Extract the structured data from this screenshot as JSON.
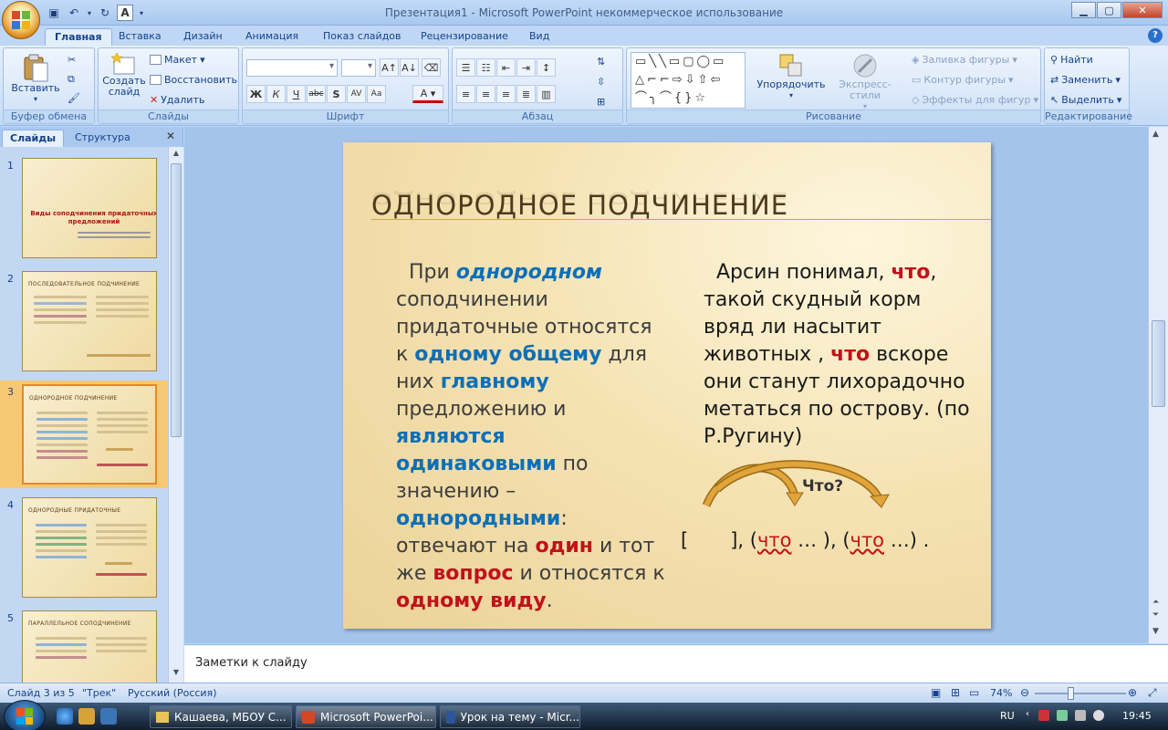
{
  "window": {
    "title": "Презентация1 - Microsoft PowerPoint некоммерческое использование"
  },
  "ribbon_tabs": [
    "Главная",
    "Вставка",
    "Дизайн",
    "Анимация",
    "Показ слайдов",
    "Рецензирование",
    "Вид"
  ],
  "ribbon": {
    "clipboard": {
      "paste": "Вставить",
      "label": "Буфер обмена"
    },
    "slides": {
      "new_slide": "Создать слайд",
      "layout": "Макет",
      "reset": "Восстановить",
      "delete": "Удалить",
      "label": "Слайды"
    },
    "font": {
      "label": "Шрифт"
    },
    "paragraph": {
      "label": "Абзац"
    },
    "drawing": {
      "arrange": "Упорядочить",
      "quick_styles": "Экспресс-стили",
      "fill": "Заливка фигуры",
      "outline": "Контур фигуры",
      "effects": "Эффекты для фигур",
      "label": "Рисование"
    },
    "editing": {
      "find": "Найти",
      "replace": "Заменить",
      "select": "Выделить",
      "label": "Редактирование"
    }
  },
  "pane_tabs": {
    "slides": "Слайды",
    "outline": "Структура"
  },
  "thumbnails": [
    {
      "num": "1",
      "title": "Виды соподчинения придаточных предложений"
    },
    {
      "num": "2",
      "title": "ПОСЛЕДОВАТЕЛЬНОЕ ПОДЧИНЕНИЕ"
    },
    {
      "num": "3",
      "title": "ОДНОРОДНОЕ ПОДЧИНЕНИЕ"
    },
    {
      "num": "4",
      "title": "ОДНОРОДНЫЕ ПРИДАТОЧНЫЕ"
    },
    {
      "num": "5",
      "title": "ПАРАЛЛЕЛЬНОЕ СОПОДЧИНЕНИЕ"
    }
  ],
  "slide": {
    "title": "Однородное подчинение",
    "left": {
      "t1": "При ",
      "b1": "однородном",
      "t2": " соподчинении придаточные относятся к ",
      "b2": "одному общему",
      "t3": " для них ",
      "b3": "главному",
      "t4": " предложению и ",
      "b4": "являются одинаковыми",
      "t5": " по значению – ",
      "b5": "однородными",
      "t6": ": отвечают на ",
      "r1": "один",
      "t7": " и тот же ",
      "r2": "вопрос",
      "t8": " и относятся к ",
      "r3": "одному виду",
      "t9": "."
    },
    "right": {
      "t1": "Арсин понимал, ",
      "r1": "что",
      "t2": ", такой скудный корм вряд ли насытит животных , ",
      "r2": "что",
      "t3": " вскоре они станут лихорадочно метаться по острову. (по Р.Ругину)"
    },
    "question": "Что?",
    "formula": {
      "open": "[",
      "close": "], (",
      "w1": "что",
      "mid": " … ), (",
      "w2": "что",
      "end": " …) ."
    }
  },
  "notes_placeholder": "Заметки к слайду",
  "status": {
    "slide": "Слайд 3 из 5",
    "theme": "\"Трек\"",
    "language": "Русский (Россия)",
    "zoom": "74%"
  },
  "taskbar": {
    "items": [
      "Кашаева, МБОУ С...",
      "Microsoft PowerPoi...",
      "Урок на тему - Micr..."
    ],
    "lang": "RU",
    "time": "19:45"
  }
}
